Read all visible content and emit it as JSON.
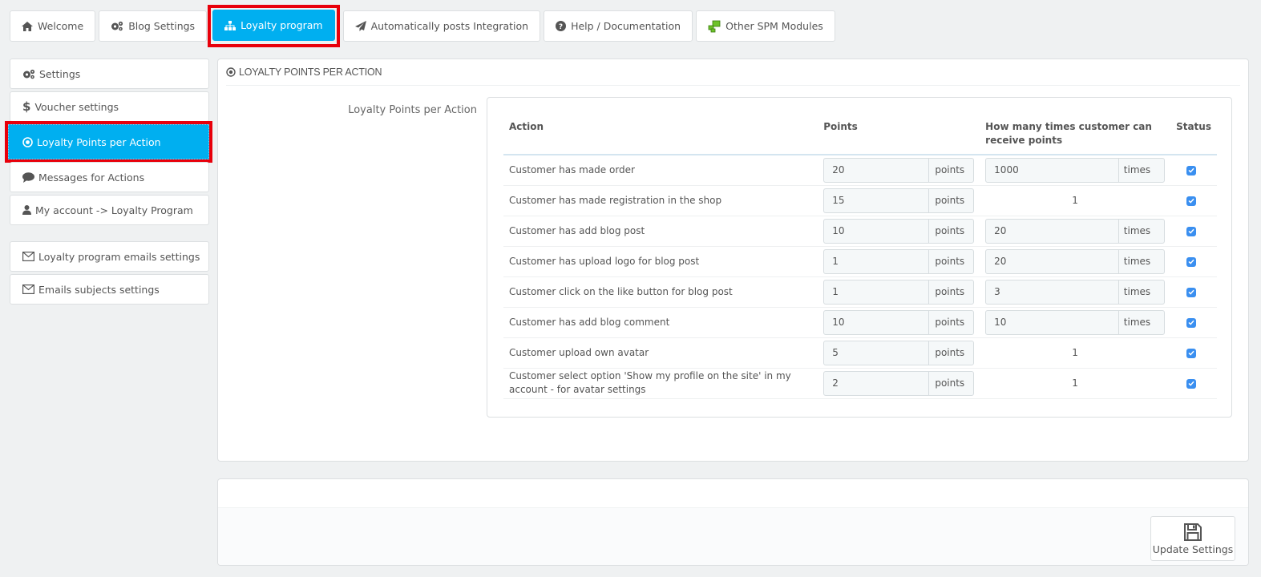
{
  "tabs": [
    {
      "label": "Welcome",
      "icon": "home-icon"
    },
    {
      "label": "Blog Settings",
      "icon": "gears-icon"
    },
    {
      "label": "Loyalty program",
      "icon": "sitemap-icon",
      "active": true
    },
    {
      "label": "Automatically posts Integration",
      "icon": "paper-plane-icon"
    },
    {
      "label": "Help / Documentation",
      "icon": "question-circle-icon"
    },
    {
      "label": "Other SPM Modules",
      "icon": "modules-icon"
    }
  ],
  "sidebar": {
    "items": [
      {
        "label": "Settings",
        "icon": "gears-icon"
      },
      {
        "label": "Voucher settings",
        "icon": "dollar-icon"
      },
      {
        "label": "Loyalty Points per Action",
        "icon": "dot-circle-icon",
        "active": true
      },
      {
        "label": "Messages for Actions",
        "icon": "comment-icon"
      },
      {
        "label": "My account -> Loyalty Program",
        "icon": "user-icon"
      },
      {
        "label": "Loyalty program emails settings",
        "icon": "envelope-icon"
      },
      {
        "label": "Emails subjects settings",
        "icon": "envelope-icon"
      }
    ]
  },
  "panel": {
    "title": "LOYALTY POINTS PER ACTION",
    "form_label": "Loyalty Points per Action"
  },
  "table": {
    "headers": {
      "action": "Action",
      "points": "Points",
      "times": "How many times customer can receive points",
      "status": "Status"
    },
    "points_suffix": "points",
    "times_suffix": "times",
    "rows": [
      {
        "action": "Customer has made order",
        "points": "20",
        "times": "1000",
        "times_editable": true,
        "status": true
      },
      {
        "action": "Customer has made registration in the shop",
        "points": "15",
        "times": "1",
        "times_editable": false,
        "status": true
      },
      {
        "action": "Customer has add blog post",
        "points": "10",
        "times": "20",
        "times_editable": true,
        "status": true
      },
      {
        "action": "Customer has upload logo for blog post",
        "points": "1",
        "times": "20",
        "times_editable": true,
        "status": true
      },
      {
        "action": "Customer click on the like button for blog post",
        "points": "1",
        "times": "3",
        "times_editable": true,
        "status": true
      },
      {
        "action": "Customer has add blog comment",
        "points": "10",
        "times": "10",
        "times_editable": true,
        "status": true
      },
      {
        "action": "Customer upload own avatar",
        "points": "5",
        "times": "1",
        "times_editable": false,
        "status": true
      },
      {
        "action": "Customer select option 'Show my profile on the site' in my account - for avatar settings",
        "points": "2",
        "times": "1",
        "times_editable": false,
        "status": true
      }
    ]
  },
  "footer": {
    "update_label": "Update Settings"
  },
  "colors": {
    "accent": "#00aff0",
    "highlight": "#e8000b",
    "checkbox": "#3a8ff0"
  }
}
